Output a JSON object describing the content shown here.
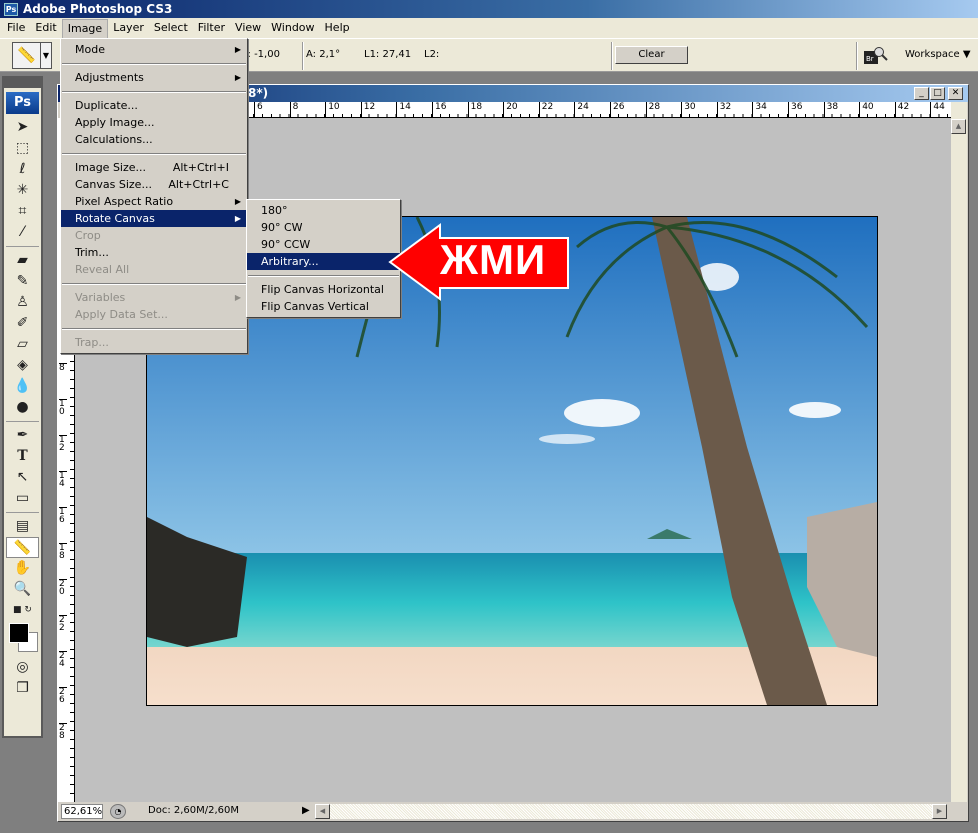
{
  "app": {
    "title": "Adobe Photoshop CS3",
    "logo": "Ps"
  },
  "menubar": [
    "File",
    "Edit",
    "Image",
    "Layer",
    "Select",
    "Filter",
    "View",
    "Window",
    "Help"
  ],
  "options": {
    "tool_icon": "ruler-icon",
    "h_readout": "H: -1,00",
    "a_readout": "A: 2,1°",
    "l1_readout": "L1: 27,41",
    "l2_readout": "L2:",
    "clear_label": "Clear",
    "bridge_label": "Br",
    "workspace_label": "Workspace ▼"
  },
  "toolbox": {
    "logo": "Ps"
  },
  "document": {
    "title_visible": "8*)",
    "top_ruler": [
      "6",
      "8",
      "10",
      "12",
      "14",
      "16",
      "18",
      "20",
      "22",
      "24",
      "26",
      "28",
      "30",
      "32",
      "34",
      "36",
      "38",
      "40",
      "42",
      "44"
    ],
    "left_ruler": [
      "8",
      "10",
      "12",
      "14",
      "16",
      "18",
      "20",
      "22",
      "24",
      "26",
      "28"
    ],
    "zoom": "62,61%",
    "doc_info": "Doc: 2,60M/2,60M"
  },
  "image_menu": {
    "groups": [
      [
        {
          "label": "Mode",
          "submenu": true
        }
      ],
      [
        {
          "label": "Adjustments",
          "submenu": true
        }
      ],
      [
        {
          "label": "Duplicate..."
        },
        {
          "label": "Apply Image..."
        },
        {
          "label": "Calculations..."
        }
      ],
      [
        {
          "label": "Image Size...",
          "shortcut": "Alt+Ctrl+I"
        },
        {
          "label": "Canvas Size...",
          "shortcut": "Alt+Ctrl+C"
        },
        {
          "label": "Pixel Aspect Ratio",
          "submenu": true
        },
        {
          "label": "Rotate Canvas",
          "submenu": true,
          "highlighted": true
        },
        {
          "label": "Crop",
          "disabled": true
        },
        {
          "label": "Trim..."
        },
        {
          "label": "Reveal All",
          "disabled": true
        }
      ],
      [
        {
          "label": "Variables",
          "submenu": true,
          "disabled": true
        },
        {
          "label": "Apply Data Set...",
          "disabled": true
        }
      ],
      [
        {
          "label": "Trap...",
          "disabled": true
        }
      ]
    ]
  },
  "rotate_menu": {
    "groups": [
      [
        {
          "label": "180°"
        },
        {
          "label": "90° CW"
        },
        {
          "label": "90° CCW"
        },
        {
          "label": "Arbitrary...",
          "highlighted": true
        }
      ],
      [
        {
          "label": "Flip Canvas Horizontal"
        },
        {
          "label": "Flip Canvas Vertical"
        }
      ]
    ]
  },
  "annotation": {
    "text": "ЖМИ",
    "color": "#ff0000"
  },
  "colors": {
    "accent": "#0a246a",
    "menu_bg": "#d4d0c8"
  }
}
